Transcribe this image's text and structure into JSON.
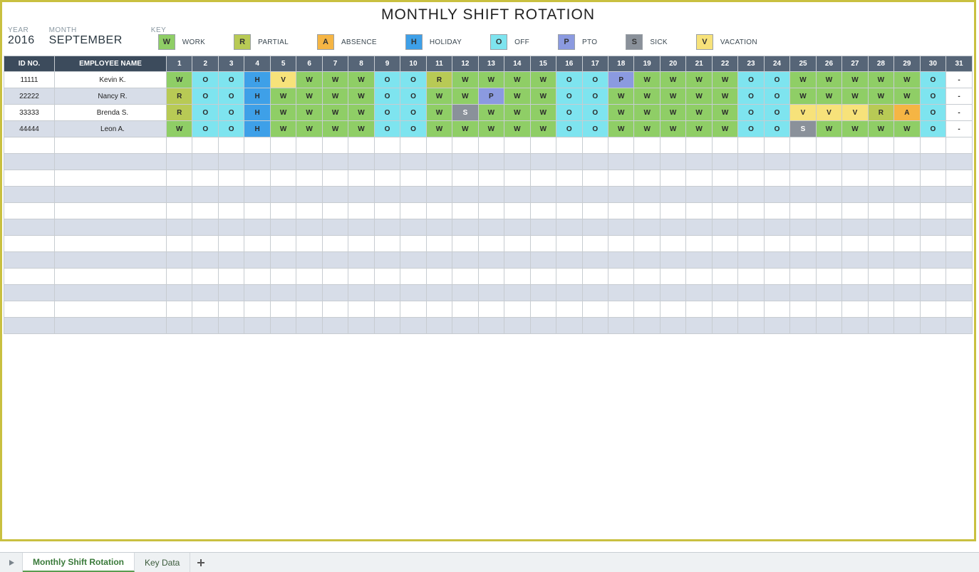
{
  "title": "MONTHLY SHIFT ROTATION",
  "meta": {
    "year_label": "YEAR",
    "year_value": "2016",
    "month_label": "MONTH",
    "month_value": "SEPTEMBER",
    "key_label": "KEY"
  },
  "legend": [
    {
      "code": "W",
      "label": "WORK",
      "color": "#8fce66"
    },
    {
      "code": "R",
      "label": "PARTIAL",
      "color": "#b8ca55"
    },
    {
      "code": "A",
      "label": "ABSENCE",
      "color": "#f5b544"
    },
    {
      "code": "H",
      "label": "HOLIDAY",
      "color": "#3ea0e8"
    },
    {
      "code": "O",
      "label": "OFF",
      "color": "#7ee4ef"
    },
    {
      "code": "P",
      "label": "PTO",
      "color": "#8b9ae0"
    },
    {
      "code": "S",
      "label": "SICK",
      "color": "#8a919a"
    },
    {
      "code": "V",
      "label": "VACATION",
      "color": "#f7e27a"
    }
  ],
  "columns": {
    "id": "ID NO.",
    "name": "EMPLOYEE NAME",
    "days": [
      "1",
      "2",
      "3",
      "4",
      "5",
      "6",
      "7",
      "8",
      "9",
      "10",
      "11",
      "12",
      "13",
      "14",
      "15",
      "16",
      "17",
      "18",
      "19",
      "20",
      "21",
      "22",
      "23",
      "24",
      "25",
      "26",
      "27",
      "28",
      "29",
      "30",
      "31"
    ]
  },
  "employees": [
    {
      "id": "11111",
      "name": "Kevin K.",
      "shifts": [
        "W",
        "O",
        "O",
        "H",
        "V",
        "W",
        "W",
        "W",
        "O",
        "O",
        "R",
        "W",
        "W",
        "W",
        "W",
        "O",
        "O",
        "P",
        "W",
        "W",
        "W",
        "W",
        "O",
        "O",
        "W",
        "W",
        "W",
        "W",
        "W",
        "O",
        "-"
      ]
    },
    {
      "id": "22222",
      "name": "Nancy R.",
      "shifts": [
        "R",
        "O",
        "O",
        "H",
        "W",
        "W",
        "W",
        "W",
        "O",
        "O",
        "W",
        "W",
        "P",
        "W",
        "W",
        "O",
        "O",
        "W",
        "W",
        "W",
        "W",
        "W",
        "O",
        "O",
        "W",
        "W",
        "W",
        "W",
        "W",
        "O",
        "-"
      ]
    },
    {
      "id": "33333",
      "name": "Brenda S.",
      "shifts": [
        "R",
        "O",
        "O",
        "H",
        "W",
        "W",
        "W",
        "W",
        "O",
        "O",
        "W",
        "S",
        "W",
        "W",
        "W",
        "O",
        "O",
        "W",
        "W",
        "W",
        "W",
        "W",
        "O",
        "O",
        "V",
        "V",
        "V",
        "R",
        "A",
        "O",
        "-"
      ]
    },
    {
      "id": "44444",
      "name": "Leon A.",
      "shifts": [
        "W",
        "O",
        "O",
        "H",
        "W",
        "W",
        "W",
        "W",
        "O",
        "O",
        "W",
        "W",
        "W",
        "W",
        "W",
        "O",
        "O",
        "W",
        "W",
        "W",
        "W",
        "W",
        "O",
        "O",
        "S",
        "W",
        "W",
        "W",
        "W",
        "O",
        "-"
      ]
    }
  ],
  "empty_rows": 12,
  "tabs": {
    "active": "Monthly Shift Rotation",
    "other": "Key Data"
  }
}
